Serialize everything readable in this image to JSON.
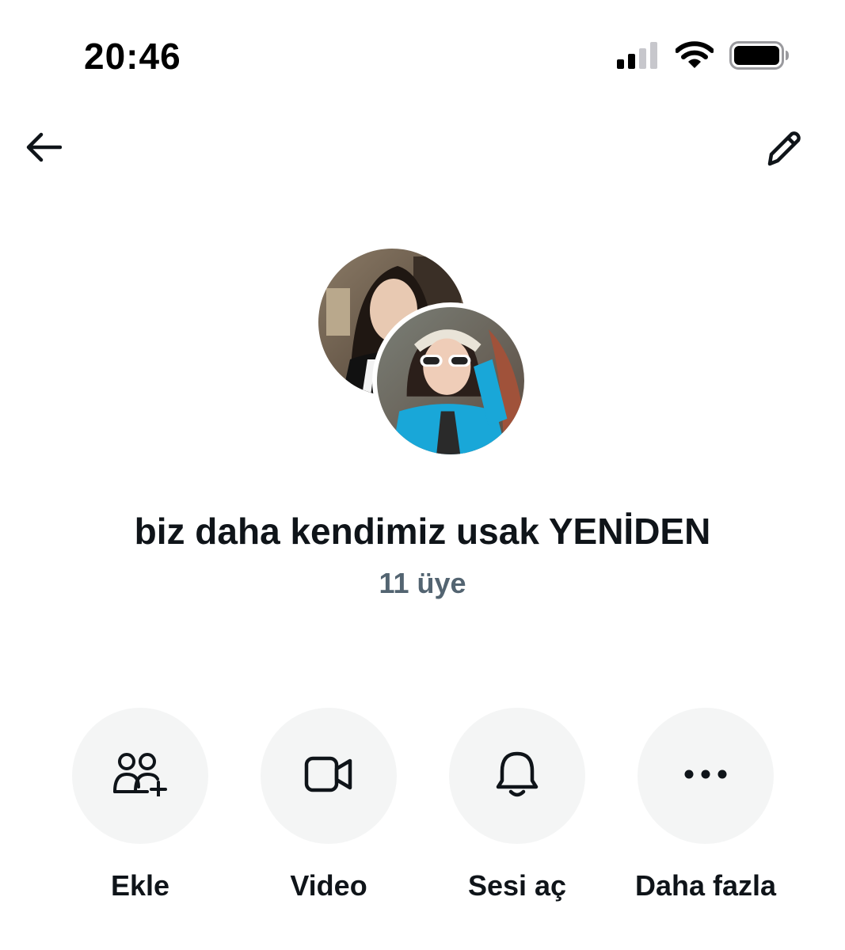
{
  "status_bar": {
    "time": "20:46",
    "signal_icon": "cellular-signal-icon",
    "wifi_icon": "wifi-icon",
    "battery_icon": "battery-icon"
  },
  "header": {
    "back_icon": "arrow-left-icon",
    "edit_icon": "pencil-icon"
  },
  "group": {
    "title": "biz daha kendimiz usak YENİDEN",
    "member_count": "11 üye"
  },
  "actions": [
    {
      "label": "Ekle",
      "icon": "add-people-icon"
    },
    {
      "label": "Video",
      "icon": "video-camera-icon"
    },
    {
      "label": "Sesi aç",
      "icon": "bell-icon"
    },
    {
      "label": "Daha fazla",
      "icon": "more-horizontal-icon"
    }
  ],
  "colors": {
    "text_primary": "#0f1419",
    "text_secondary": "#536471",
    "action_background": "#f4f5f5"
  }
}
